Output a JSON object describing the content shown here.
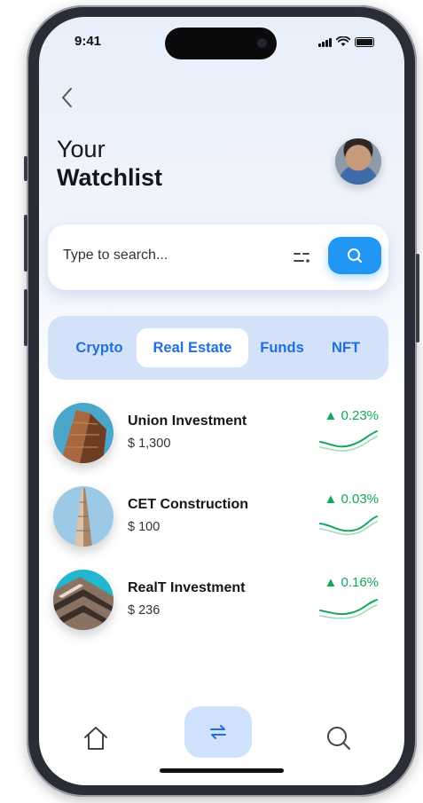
{
  "status_bar": {
    "time": "9:41"
  },
  "header": {
    "back_icon": "chevron-left-icon",
    "title_line1": "Your",
    "title_line2": "Watchlist",
    "avatar_icon": "user-avatar"
  },
  "search": {
    "placeholder": "Type to search...",
    "value": "",
    "filter_icon": "filter-icon",
    "button_icon": "search-icon"
  },
  "tabs": [
    {
      "label": "Crypto",
      "active": false
    },
    {
      "label": "Real Estate",
      "active": true
    },
    {
      "label": "Funds",
      "active": false
    },
    {
      "label": "NFT",
      "active": false
    }
  ],
  "watchlist": [
    {
      "name": "Union Investment",
      "price": "$ 1,300",
      "change": "▲ 0.23%"
    },
    {
      "name": "CET Construction",
      "price": "$ 100",
      "change": "▲ 0.03%"
    },
    {
      "name": "RealT Investment",
      "price": "$ 236",
      "change": "▲ 0.16%"
    }
  ],
  "colors": {
    "accent": "#2196f3",
    "positive": "#10a85a",
    "tab_bg": "#d3e2f8"
  },
  "bottom_nav": {
    "home_icon": "home-icon",
    "swap_icon": "swap-arrows-icon",
    "search_icon": "search-icon"
  }
}
